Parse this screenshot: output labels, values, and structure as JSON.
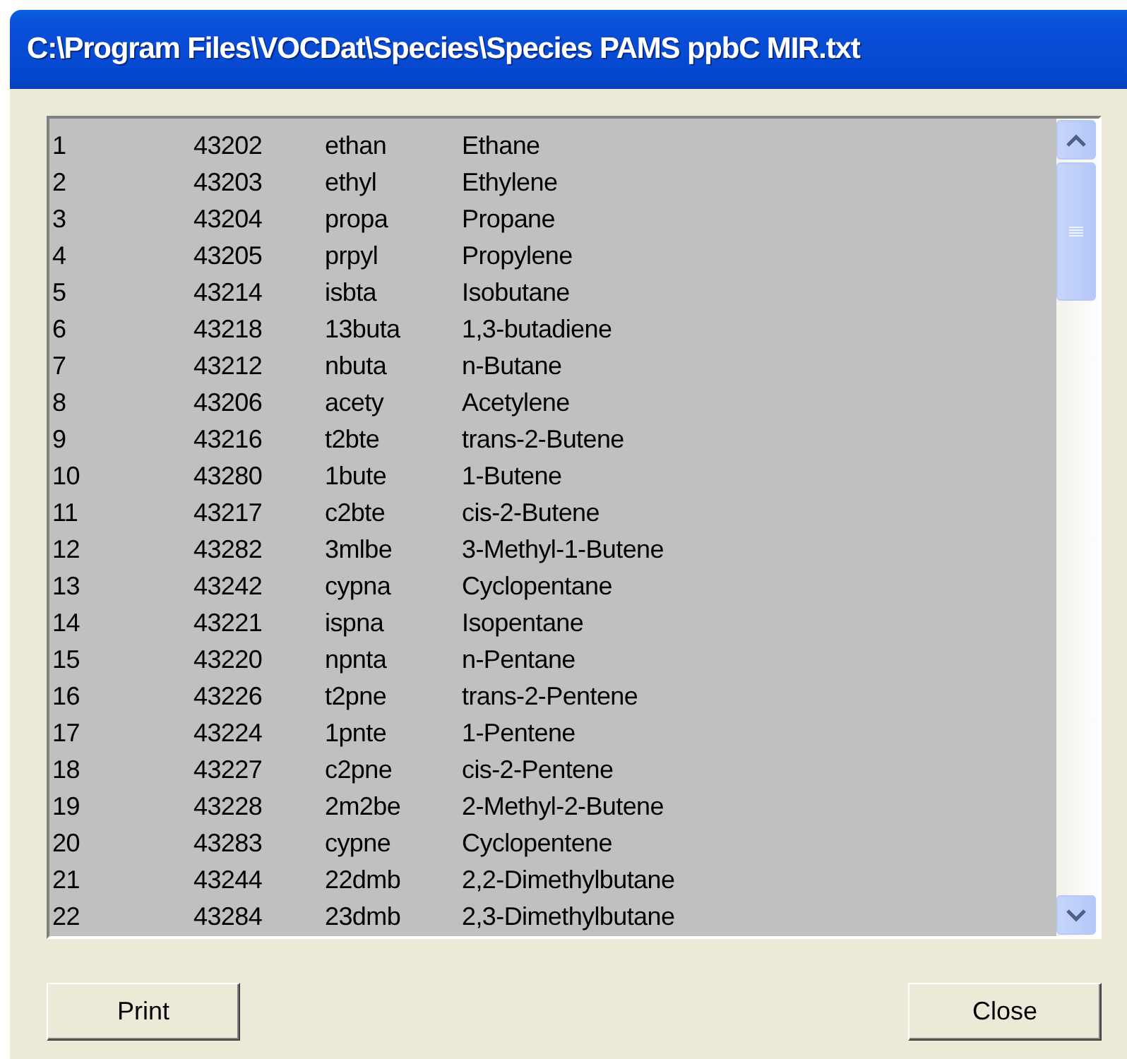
{
  "window": {
    "title": "C:\\Program Files\\VOCDat\\Species\\Species PAMS ppbC MIR.txt"
  },
  "listing": {
    "rows": [
      [
        "1",
        "43202",
        "ethan",
        "Ethane"
      ],
      [
        "2",
        "43203",
        "ethyl",
        "Ethylene"
      ],
      [
        "3",
        "43204",
        "propa",
        "Propane"
      ],
      [
        "4",
        "43205",
        "prpyl",
        "Propylene"
      ],
      [
        "5",
        "43214",
        "isbta",
        "Isobutane"
      ],
      [
        "6",
        "43218",
        "13buta",
        "1,3-butadiene"
      ],
      [
        "7",
        "43212",
        "nbuta",
        "n-Butane"
      ],
      [
        "8",
        "43206",
        "acety",
        "Acetylene"
      ],
      [
        "9",
        "43216",
        "t2bte",
        "trans-2-Butene"
      ],
      [
        "10",
        "43280",
        "1bute",
        "1-Butene"
      ],
      [
        "11",
        "43217",
        "c2bte",
        "cis-2-Butene"
      ],
      [
        "12",
        "43282",
        "3mlbe",
        "3-Methyl-1-Butene"
      ],
      [
        "13",
        "43242",
        "cypna",
        "Cyclopentane"
      ],
      [
        "14",
        "43221",
        "ispna",
        "Isopentane"
      ],
      [
        "15",
        "43220",
        "npnta",
        "n-Pentane"
      ],
      [
        "16",
        "43226",
        "t2pne",
        "trans-2-Pentene"
      ],
      [
        "17",
        "43224",
        "1pnte",
        "1-Pentene"
      ],
      [
        "18",
        "43227",
        "c2pne",
        "cis-2-Pentene"
      ],
      [
        "19",
        "43228",
        "2m2be",
        "2-Methyl-2-Butene"
      ],
      [
        "20",
        "43283",
        "cypne",
        "Cyclopentene"
      ],
      [
        "21",
        "43244",
        "22dmb",
        "2,2-Dimethylbutane"
      ],
      [
        "22",
        "43284",
        "23dmb",
        "2,3-Dimethylbutane"
      ]
    ]
  },
  "buttons": [
    "Print",
    "Close"
  ]
}
